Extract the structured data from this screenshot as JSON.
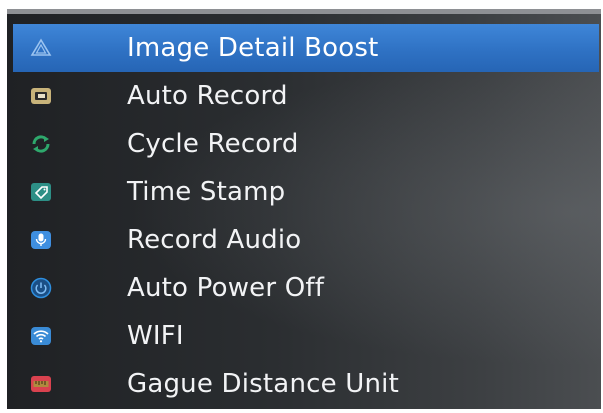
{
  "menu": {
    "items": [
      {
        "label": "Image Detail Boost",
        "icon": "triangle-outline-icon",
        "selected": true
      },
      {
        "label": "Auto Record",
        "icon": "card-icon"
      },
      {
        "label": "Cycle Record",
        "icon": "cycle-arrows-icon"
      },
      {
        "label": "Time Stamp",
        "icon": "tag-icon"
      },
      {
        "label": "Record Audio",
        "icon": "microphone-icon"
      },
      {
        "label": "Auto Power Off",
        "icon": "power-icon"
      },
      {
        "label": "WIFI",
        "icon": "wifi-icon"
      },
      {
        "label": "Gague Distance Unit",
        "icon": "ruler-icon"
      }
    ]
  },
  "colors": {
    "selection": "#2f72c4",
    "text": "#f2f3f5",
    "card_icon": "#c8b37a",
    "cycle_icon": "#2ea86c",
    "tag_icon": "#2d8f86",
    "mic_icon": "#3f8fe0",
    "power_icon": "#2e8fe0",
    "wifi_icon": "#3a8bd6",
    "ruler_icon": "#d9424f"
  }
}
